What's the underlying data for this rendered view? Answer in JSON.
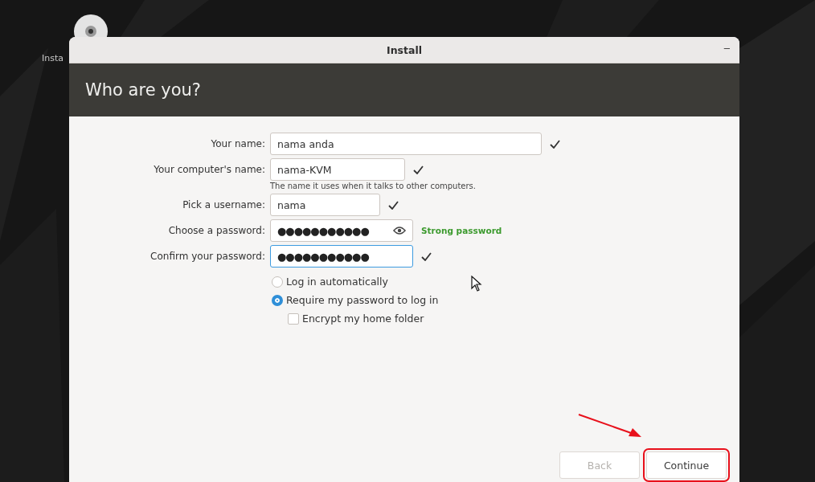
{
  "desktop": {
    "icon_label": "Insta"
  },
  "window": {
    "title": "Install",
    "minimize": "–"
  },
  "header": {
    "title": "Who are you?"
  },
  "fields": [
    {
      "kind": "text",
      "label": "Your name:",
      "value": "nama anda",
      "valid": true,
      "focused": false
    },
    {
      "kind": "text",
      "label": "Your computer's name:",
      "value": "nama-KVM",
      "valid": true,
      "focused": false,
      "hint": "The name it uses when it talks to other computers."
    },
    {
      "kind": "text",
      "label": "Pick a username:",
      "value": "nama",
      "valid": true,
      "focused": false
    },
    {
      "kind": "password",
      "label": "Choose a password:",
      "value": "●●●●●●●●●●●",
      "valid": false,
      "focused": false,
      "reveal_toggle": true,
      "strength": "Strong password"
    },
    {
      "kind": "password",
      "label": "Confirm your password:",
      "value": "●●●●●●●●●●●",
      "valid": true,
      "focused": true
    }
  ],
  "login_options": [
    {
      "label": "Log in automatically",
      "selected": false
    },
    {
      "label": "Require my password to log in",
      "selected": true
    }
  ],
  "encrypt": {
    "label": "Encrypt my home folder",
    "checked": false
  },
  "buttons": [
    {
      "label": "Back",
      "disabled": true,
      "highlighted": false
    },
    {
      "label": "Continue",
      "disabled": false,
      "highlighted": true
    }
  ]
}
